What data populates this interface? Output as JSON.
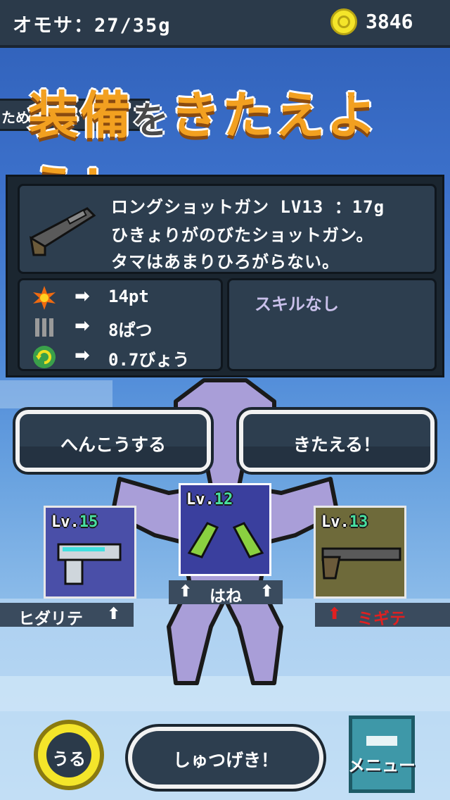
{
  "status": {
    "weight_text": "オモサ：27/35g",
    "coins": "3846"
  },
  "title": {
    "part1": "装備",
    "part2": "を",
    "part3": "きたえよう！",
    "side_tab": "ため"
  },
  "weapon": {
    "name_line": "ロングショットガン LV13 ：17g",
    "desc_line1": "ひきょりがのびたショットガン。",
    "desc_line2": "タマはあまりひろがらない。",
    "icon": "shotgun-icon"
  },
  "stats": [
    {
      "icon": "explosion-icon",
      "value": "14pt"
    },
    {
      "icon": "ammo-icon",
      "value": "8ぱつ"
    },
    {
      "icon": "reload-icon",
      "value": "0.7びょう"
    }
  ],
  "skill": "スキルなし",
  "buttons": {
    "change": "へんこうする",
    "upgrade": "きたえる！",
    "sell": "うる",
    "sortie": "しゅつげき！",
    "menu": "メニュー"
  },
  "slots": {
    "left": {
      "lv_prefix": "Lv.",
      "lv": "15",
      "label": "ヒダリテ",
      "arrow": "⬆"
    },
    "center": {
      "lv_prefix": "Lv.",
      "lv": "12",
      "label": "はね",
      "arrow": "⬆"
    },
    "right": {
      "lv_prefix": "Lv.",
      "lv": "13",
      "label": "ミギテ",
      "arrow": "⬆"
    }
  },
  "colors": {
    "accent_orange": "#f2a020",
    "level_green": "#48e0a0",
    "panel": "#2d3e4f",
    "coin": "#f4e52a",
    "red_arrow": "#e02020"
  }
}
